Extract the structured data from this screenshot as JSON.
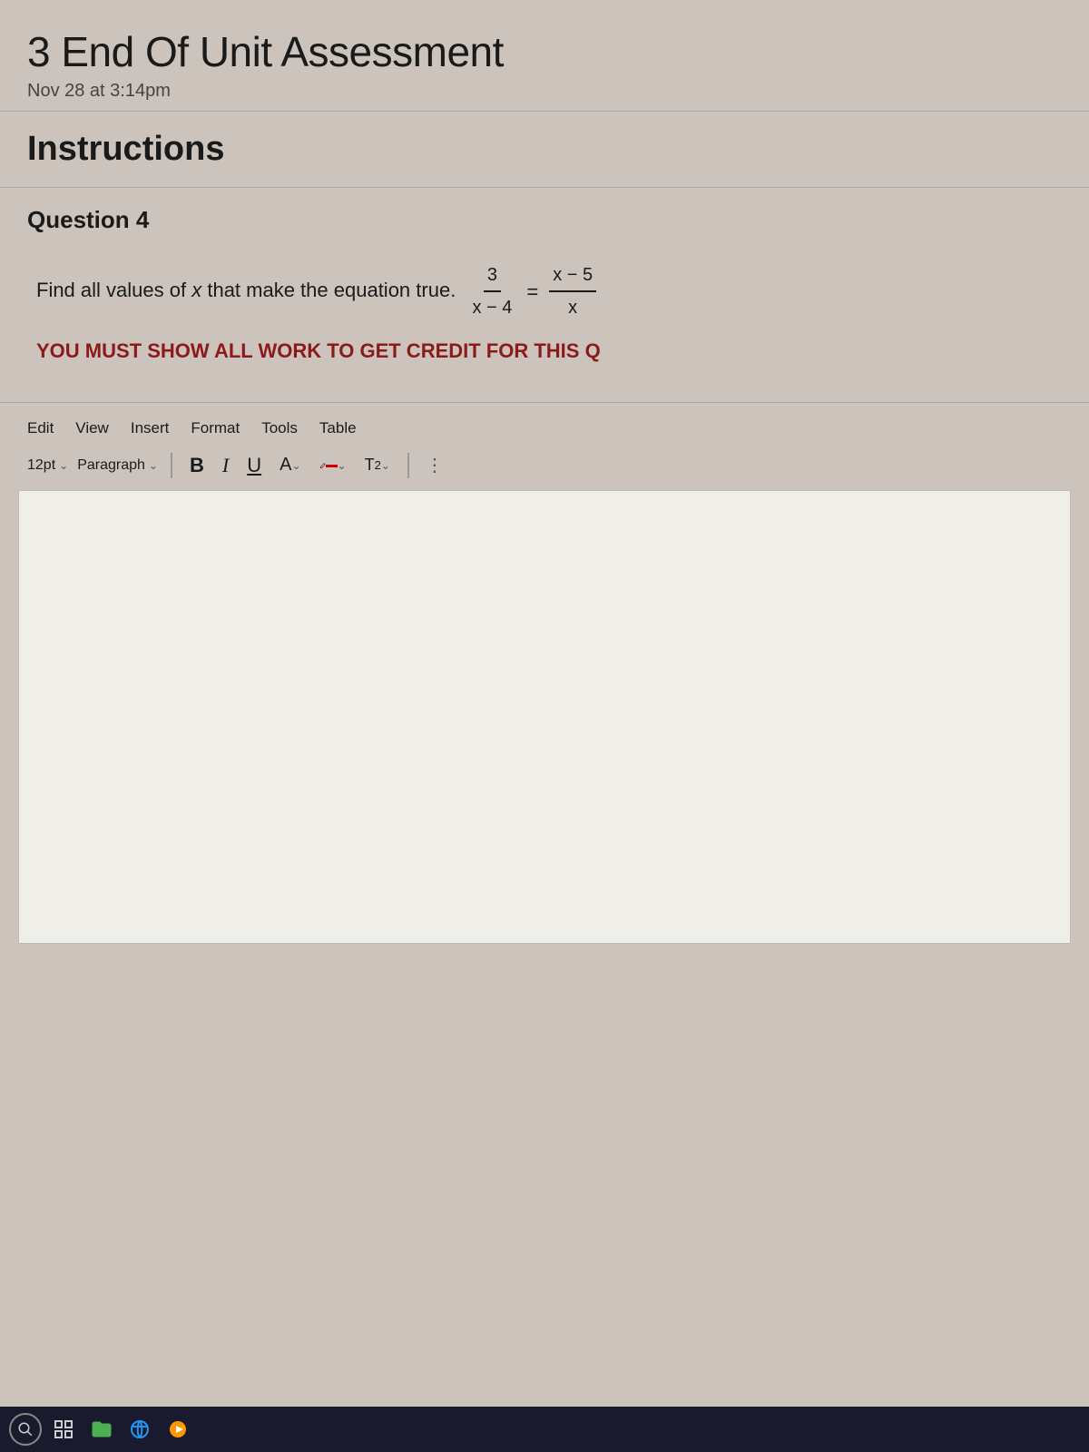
{
  "page": {
    "title": "3 End Of Unit Assessment",
    "subtitle": "Nov 28 at 3:14pm",
    "instructions_label": "Instructions",
    "question_label": "Question 4",
    "question_text_prefix": "Find all values of",
    "question_variable": "x",
    "question_text_suffix": "that make the equation true.",
    "equation": {
      "lhs_numerator": "3",
      "lhs_denominator": "x − 4",
      "equals": "=",
      "rhs_numerator": "x − 5",
      "rhs_denominator": "x"
    },
    "warning_text": "YOU MUST SHOW ALL WORK TO GET CREDIT FOR THIS Q",
    "editor": {
      "menu_items": [
        "Edit",
        "View",
        "Insert",
        "Format",
        "Tools",
        "Table"
      ],
      "font_size": "12pt",
      "font_size_label": "12pt",
      "paragraph_label": "Paragraph",
      "toolbar": {
        "bold_label": "B",
        "italic_label": "I",
        "underline_label": "U",
        "font_color_label": "A",
        "highlight_label": "🖊",
        "superscript_label": "T",
        "superscript_exp": "2",
        "more_label": "⋮"
      }
    }
  },
  "taskbar": {
    "search_icon": "search",
    "grid_icon": "grid",
    "folder_icon": "folder",
    "browser_icon": "browser",
    "media_icon": "media"
  }
}
